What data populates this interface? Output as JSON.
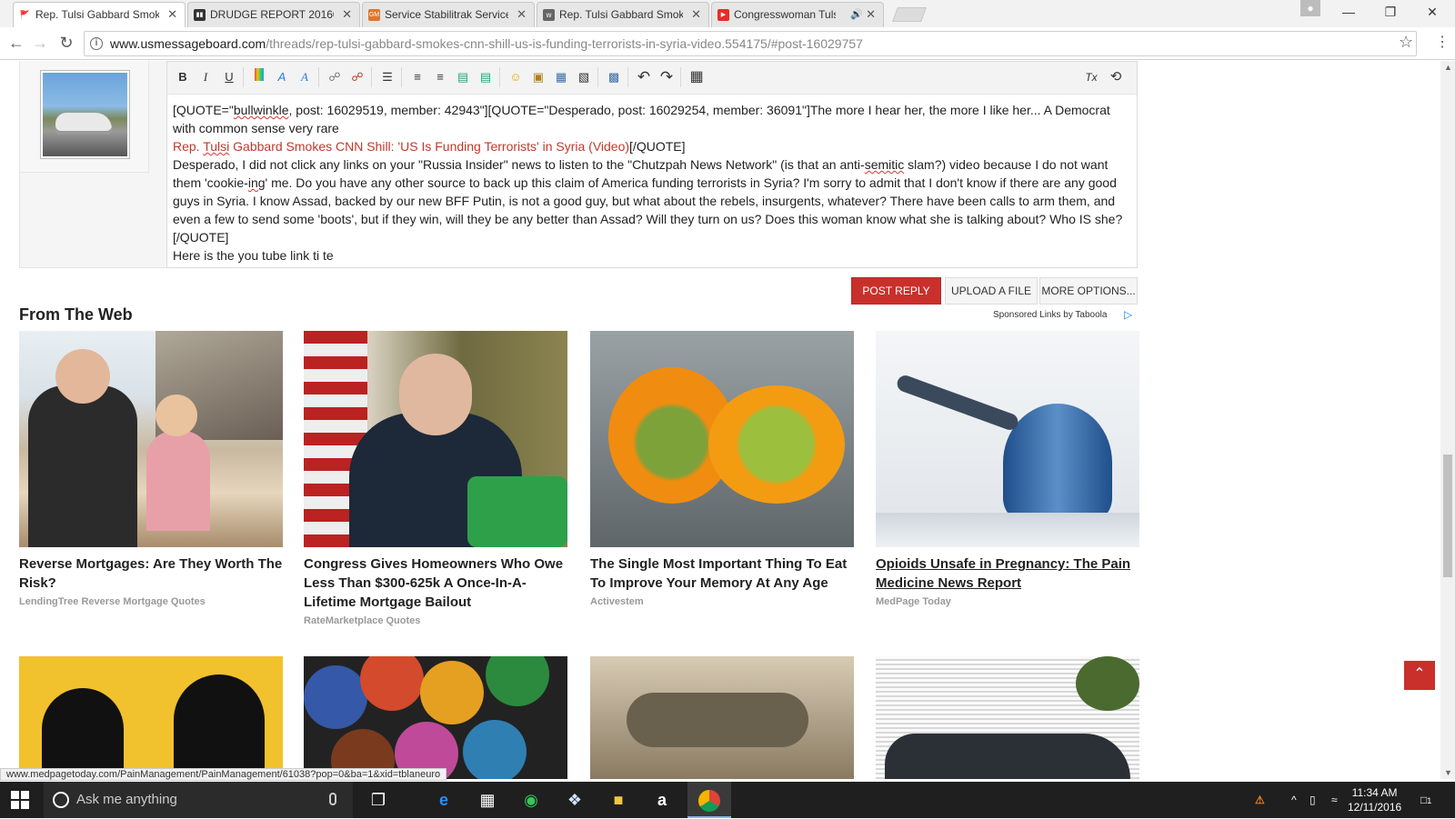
{
  "tabs": [
    {
      "title": "Rep. Tulsi Gabbard Smok",
      "favicon_color": "#ffffff",
      "favicon_text": "🚩",
      "active": true
    },
    {
      "title": "DRUDGE REPORT 2016®",
      "favicon_color": "#333333",
      "favicon_text": "▮▮",
      "active": false
    },
    {
      "title": "Service Stabilitrak Service",
      "favicon_color": "#e0752d",
      "favicon_text": "GM",
      "active": false
    },
    {
      "title": "Rep. Tulsi Gabbard Smok",
      "favicon_color": "#666666",
      "favicon_text": "w",
      "active": false
    },
    {
      "title": "Congresswoman Tuls",
      "favicon_color": "#e52d27",
      "favicon_text": "▶",
      "active": false
    }
  ],
  "tab_close_glyph": "✕",
  "tab_audio_glyph": "🔊",
  "window_controls": {
    "minimize": "—",
    "maximize": "❐",
    "close": "✕"
  },
  "nav": {
    "back": "←",
    "forward": "→",
    "reload": "↻"
  },
  "address": {
    "host": "www.usmessageboard.com",
    "path": "/threads/rep-tulsi-gabbard-smokes-cnn-shill-us-is-funding-terrorists-in-syria-video.554175/#post-16029757",
    "info_glyph": "i"
  },
  "star_glyph": "☆",
  "menu_glyph": "⋮",
  "editor": {
    "toolbar": {
      "bold": "B",
      "italic": "I",
      "underline": "U",
      "undo": "↶",
      "redo": "↷",
      "table": "▦",
      "remove_format": "Tx",
      "toggle": "⟲"
    },
    "lines": {
      "quote_start_a": "[QUOTE=\"",
      "quote_user": "bullwinkle",
      "quote_start_b": ", post: 16029519, member: 42943\"][QUOTE=\"Desperado, post: 16029254, member: 36091\"]The more I hear her, the more I like her... A Democrat with common sense very rare",
      "link_prefix": "Rep. ",
      "link_tulsi": "Tulsi",
      "link_text": " Gabbard Smokes CNN Shill: 'US Is Funding Terrorists' in Syria (Video)",
      "link_suffix": "[/QUOTE]",
      "body_a": "Desperado, I did not click any links on your \"Russia Insider\" news to listen to the \"Chutzpah News Network\" (is that an anti-",
      "body_semitic": "semitic",
      "body_b": " slam?) video because I do not want them 'cookie-",
      "body_ing": "ing",
      "body_c": "' me.  Do you have any other source to back up this claim of America funding terrorists in Syria?  I'm sorry to admit that I don't know if there are any good guys in Syria.  I know Assad, backed by our new BFF Putin, is not a good guy, but what about the rebels, insurgents, whatever?  There have been calls to arm them, and even a few to send some 'boots', but if they win, will they be any better than Assad?  Will they turn on us?  Does this woman know what she is talking about?  Who IS she?[/QUOTE]",
      "last_line": "Here is the you tube link ti te"
    }
  },
  "buttons": {
    "post_reply": "POST REPLY",
    "upload": "UPLOAD A FILE",
    "more_options": "MORE OPTIONS..."
  },
  "from_the_web": "From The Web",
  "sponsored": "Sponsored Links by Taboola",
  "taboola_glyph": "▷",
  "ad_close_glyph": "⊠",
  "cards": [
    {
      "headline": "Reverse Mortgages: Are They Worth The Risk?",
      "source": "LendingTree Reverse Mortgage Quotes",
      "underlined": false
    },
    {
      "headline": "Congress Gives Homeowners Who Owe Less Than $300-625k A Once-In-A-Lifetime Mortgage Bailout",
      "source": "RateMarketplace Quotes",
      "underlined": false
    },
    {
      "headline": "The Single Most Important Thing To Eat To Improve Your Memory At Any Age",
      "source": "Activestem",
      "underlined": false
    },
    {
      "headline": "Opioids Unsafe in Pregnancy: The Pain Medicine News Report",
      "source": "MedPage Today",
      "underlined": true
    }
  ],
  "back_to_top_glyph": "⌃",
  "status_url": "www.medpagetoday.com/PainManagement/PainManagement/61038?pop=0&ba=1&xid=tblaneuro",
  "taskbar": {
    "search_placeholder": "Ask me anything",
    "clock_time": "11:34 AM",
    "clock_date": "12/11/2016",
    "notification_count": "1",
    "tray_up": "^"
  }
}
